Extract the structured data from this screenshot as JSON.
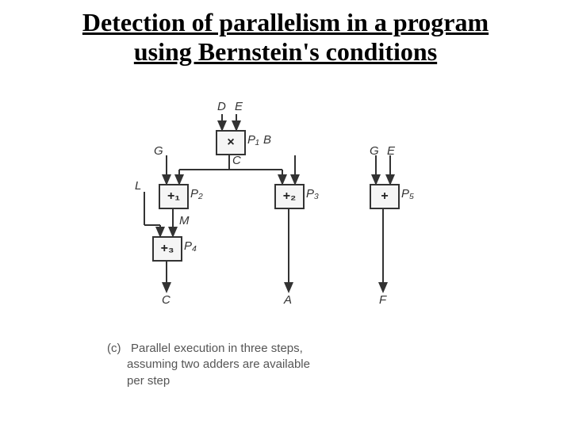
{
  "title": {
    "line1": "Detection of parallelism in a program",
    "line2": "using Bernstein's conditions"
  },
  "nodes": {
    "p1": {
      "op": "×",
      "label": "P₁"
    },
    "p2": {
      "op": "+₁",
      "label": "P₂"
    },
    "p3": {
      "op": "+₂",
      "label": "P₃"
    },
    "p4": {
      "op": "+₃",
      "label": "P₄"
    },
    "p5": {
      "op": "+",
      "label": "P₅"
    }
  },
  "signals": {
    "D": "D",
    "E": "E",
    "G": "G",
    "B": "B",
    "L": "L",
    "GE_G": "G",
    "GE_E": "E",
    "C_top": "C",
    "M": "M",
    "C_out": "C",
    "A_out": "A",
    "F_out": "F"
  },
  "caption": {
    "tag": "(c)",
    "text1": "Parallel execution in three steps,",
    "text2": "assuming two adders are available",
    "text3": "per step"
  },
  "chart_data": {
    "type": "diagram",
    "title": "Parallel execution dataflow graph (Bernstein's conditions)",
    "processes": [
      {
        "id": "P1",
        "op": "multiply",
        "inputs": [
          "D",
          "E"
        ],
        "output": "C"
      },
      {
        "id": "P2",
        "op": "add",
        "inputs": [
          "G",
          "C"
        ],
        "output": "M"
      },
      {
        "id": "P3",
        "op": "add",
        "inputs": [
          "C",
          "B"
        ],
        "output": "A"
      },
      {
        "id": "P4",
        "op": "add",
        "inputs": [
          "L",
          "M"
        ],
        "output": "C"
      },
      {
        "id": "P5",
        "op": "add",
        "inputs": [
          "G",
          "E"
        ],
        "output": "F"
      }
    ],
    "steps": 3,
    "adders_per_step": 2
  }
}
